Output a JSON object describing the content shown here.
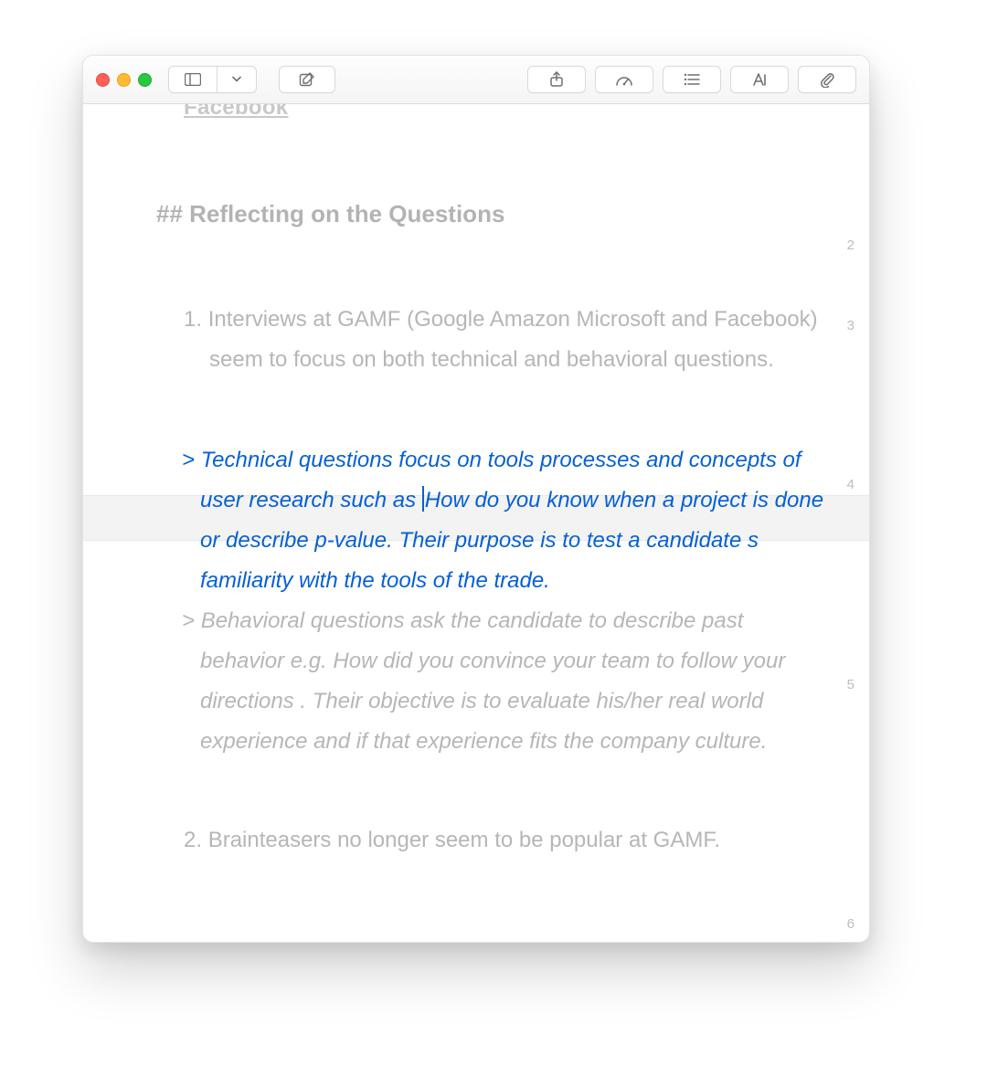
{
  "toolbar": {
    "icons": {
      "sidebar": "sidebar-icon",
      "chevron": "chevron-down-icon",
      "compose": "compose-icon",
      "share": "share-icon",
      "gauge": "gauge-icon",
      "list": "list-icon",
      "text": "text-style-icon",
      "attach": "paperclip-icon"
    }
  },
  "doc": {
    "cut_heading": "Facebook",
    "h2_prefix": "##",
    "h2": "Reflecting on the Questions",
    "p1_num": "1.",
    "p1": "Interviews at GAMF (Google Amazon Microsoft and Facebook) seem to focus on both technical and behavioral questions.",
    "q_mark": ">",
    "q1a": "Technical questions focus on tools processes and concepts of user research such as ",
    "q1b": "How do you know when a project is done or describe p-value. Their purpose is to test a candidate s familiarity with the tools of the trade.",
    "q2": "Behavioral questions ask the candidate to describe past behavior e.g. How did you convince your team to follow your directions . Their objective is to evaluate his/her real world experience and if that experience fits the company culture.",
    "p2_num": "2.",
    "p2": "Brainteasers no longer seem to be popular at GAMF."
  },
  "line_numbers": {
    "h2": "2",
    "p1": "3",
    "q1": "4",
    "q2": "5",
    "p2": "6"
  }
}
